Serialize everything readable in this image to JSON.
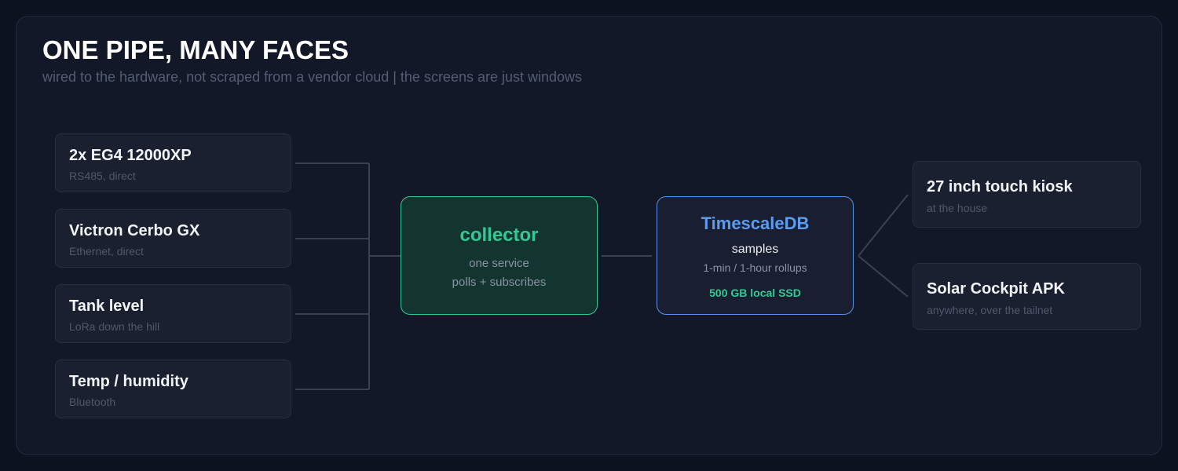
{
  "header": {
    "title": "ONE PIPE, MANY FACES",
    "subtitle": "wired to the hardware, not scraped from a vendor cloud  |  the screens are just windows"
  },
  "sources": [
    {
      "title": "2x EG4 12000XP",
      "subtitle": "RS485, direct"
    },
    {
      "title": "Victron Cerbo GX",
      "subtitle": "Ethernet, direct"
    },
    {
      "title": "Tank level",
      "subtitle": "LoRa down the hill"
    },
    {
      "title": "Temp / humidity",
      "subtitle": "Bluetooth"
    }
  ],
  "collector": {
    "title": "collector",
    "line1": "one service",
    "line2": "polls + subscribes"
  },
  "database": {
    "title": "TimescaleDB",
    "line1": "samples",
    "line2": "1-min / 1-hour rollups",
    "line3": "500 GB local SSD"
  },
  "outputs": [
    {
      "title": "27 inch touch kiosk",
      "subtitle": "at the house"
    },
    {
      "title": "Solar Cockpit APK",
      "subtitle": "anywhere, over the tailnet"
    }
  ],
  "colors": {
    "background": "#0d1220",
    "panel": "#121827",
    "card": "#1a2030",
    "collector_accent": "#34c994",
    "database_accent": "#5b93e8",
    "connector": "#3a4252"
  }
}
